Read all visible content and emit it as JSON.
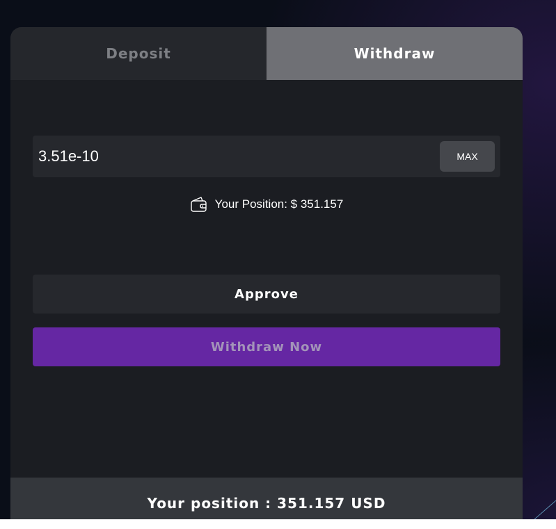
{
  "tabs": {
    "deposit_label": "Deposit",
    "withdraw_label": "Withdraw",
    "active": "Withdraw"
  },
  "amount": {
    "value": "3.51e-10",
    "max_label": "MAX"
  },
  "position": {
    "icon": "wallet-icon",
    "label": "Your Position: $ 351.157"
  },
  "actions": {
    "approve_label": "Approve",
    "withdraw_now_label": "Withdraw Now"
  },
  "footer": {
    "text": "Your position : 351.157 USD"
  },
  "colors": {
    "accent": "#6527a3",
    "card_bg": "#1b1d22",
    "active_tab": "#6f7075"
  }
}
